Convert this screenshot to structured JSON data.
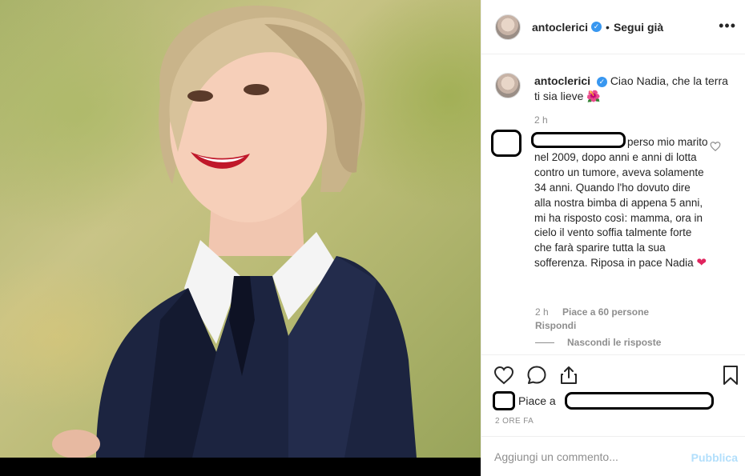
{
  "post": {
    "image_alt": "",
    "header": {
      "username": "antoclerici",
      "separator": "•",
      "follow_label": "Segui già",
      "more_label": "•••"
    },
    "caption": {
      "username": "antoclerici",
      "text": "Ciao Nadia, che la terra ti sia lieve",
      "emoji": "🌺",
      "time": "2 h"
    },
    "reply": {
      "text": "perso mio marito nel 2009, dopo anni e anni di lotta contro un tumore, aveva solamente 34 anni. Quando l'ho dovuto dire alla nostra bimba di appena 5 anni, mi ha risposto così: mamma, ora in cielo il vento soffia talmente forte che farà sparire tutta la sua sofferenza. Riposa in pace Nadia",
      "heart": "❤",
      "time": "2 h",
      "likes": "Piace a 60 persone",
      "reply_label": "Rispondi",
      "hide_replies_label": "Nascondi le risposte"
    },
    "likes_prefix": "Piace a",
    "time_ago": "2 ORE FA",
    "comment_placeholder": "Aggiungi un commento...",
    "publish_label": "Pubblica"
  },
  "colors": {
    "accent": "#3897f0",
    "publish_disabled": "#b2dffc",
    "secondary_text": "#8e8e8e",
    "heart_red": "#e0245e"
  },
  "icons": {
    "like": "heart-outline-icon",
    "comment": "speech-bubble-icon",
    "share": "share-upload-icon",
    "save": "bookmark-icon",
    "verified": "verified-badge-icon",
    "more": "more-options-icon"
  }
}
